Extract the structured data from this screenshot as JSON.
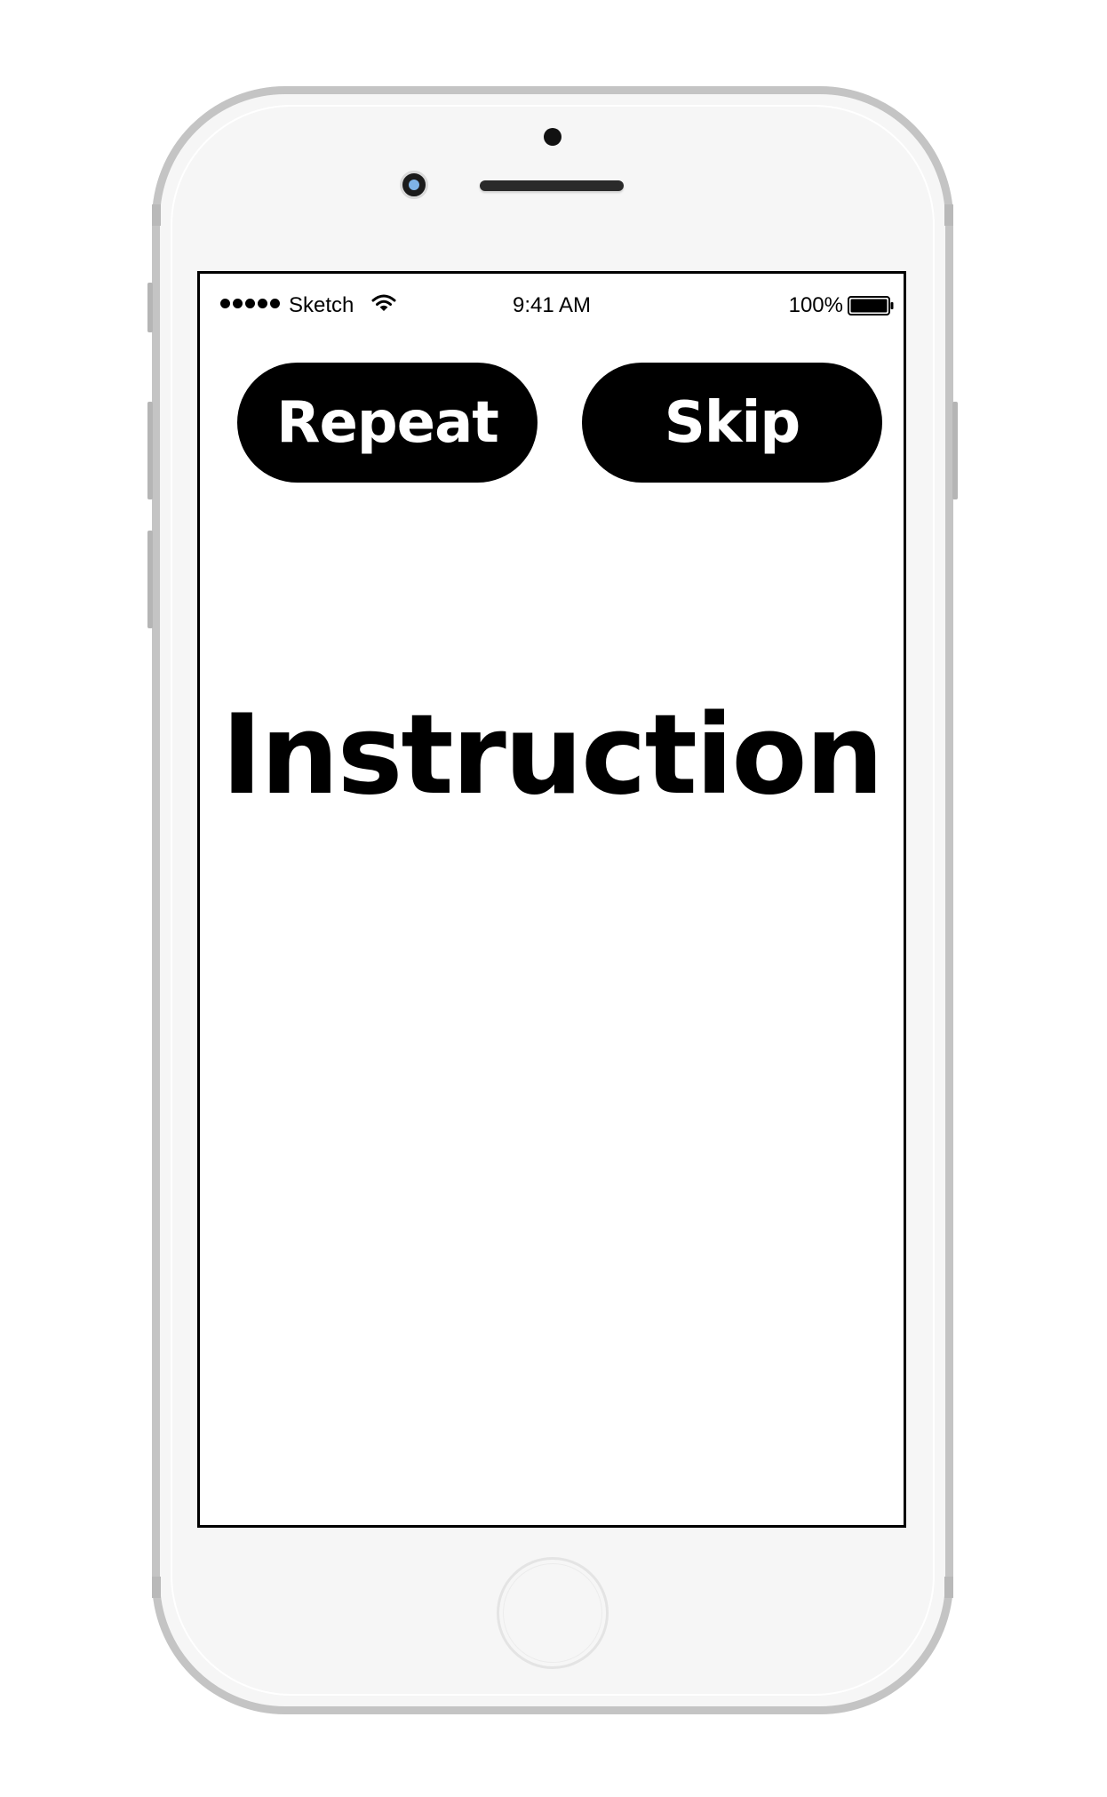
{
  "status_bar": {
    "carrier": "Sketch",
    "time": "9:41 AM",
    "battery_percent": "100%",
    "signal_icon": "signal-dots-icon",
    "wifi_icon": "wifi-icon",
    "battery_icon": "battery-icon",
    "battery_level": 1.0
  },
  "controls": {
    "repeat_label": "Repeat",
    "skip_label": "Skip"
  },
  "main": {
    "instruction_text": "Instruction"
  },
  "colors": {
    "button_bg": "#000000",
    "button_text": "#ffffff",
    "screen_bg": "#ffffff",
    "device_frame": "#c4c4c4"
  }
}
